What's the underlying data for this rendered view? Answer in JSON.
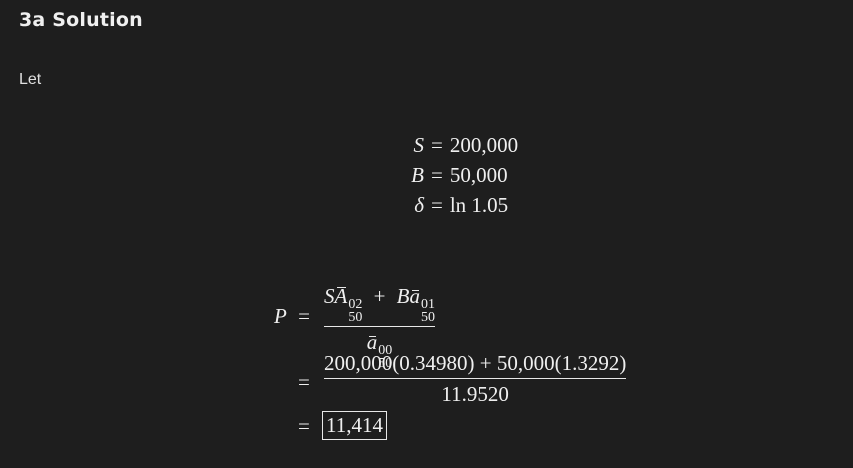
{
  "heading": "3a Solution",
  "intro": "Let",
  "definitions": [
    {
      "lhs": "S",
      "op": "=",
      "rhs": "200,000"
    },
    {
      "lhs": "B",
      "op": "=",
      "rhs": "50,000"
    },
    {
      "lhs": "δ",
      "op": "=",
      "rhs": "ln 1.05"
    }
  ],
  "premium": {
    "lhs": "P",
    "op": "=",
    "step1": {
      "numerator": {
        "term1_coef": "S",
        "term1_sym": "A",
        "term1_sup": "02",
        "term1_sub": "50",
        "plus": "+",
        "term2_coef": "B",
        "term2_sym": "a",
        "term2_sup": "01",
        "term2_sub": "50"
      },
      "denominator": {
        "sym": "a",
        "sup": "00",
        "sub": "50"
      }
    },
    "step2": {
      "numerator": "200,000(0.34980) + 50,000(1.3292)",
      "denominator": "11.9520"
    },
    "result": "11,414"
  }
}
